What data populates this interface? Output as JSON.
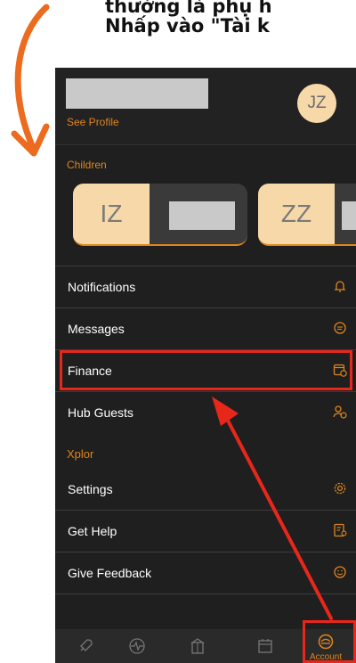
{
  "caption": {
    "line1": "thường là phụ h",
    "line2": "Nhấp vào \"Tài k"
  },
  "profile": {
    "see_profile": "See Profile",
    "avatar_initials": "JZ"
  },
  "children": {
    "label": "Children",
    "items": [
      {
        "initials": "IZ"
      },
      {
        "initials": "ZZ"
      }
    ]
  },
  "menu": {
    "items": [
      {
        "label": "Notifications",
        "icon": "bell-icon"
      },
      {
        "label": "Messages",
        "icon": "chat-bubble-icon"
      },
      {
        "label": "Finance",
        "icon": "wallet-dollar-icon"
      },
      {
        "label": "Hub Guests",
        "icon": "user-plus-icon"
      }
    ],
    "section": "Xplor",
    "section_items": [
      {
        "label": "Settings",
        "icon": "gear-icon"
      },
      {
        "label": "Get Help",
        "icon": "help-document-icon"
      },
      {
        "label": "Give Feedback",
        "icon": "feedback-smile-icon"
      }
    ]
  },
  "tabbar": {
    "tabs": [
      {
        "icon": "rocket-icon"
      },
      {
        "icon": "activity-icon"
      },
      {
        "icon": "building-icon"
      },
      {
        "icon": "calendar-icon"
      },
      {
        "icon": "account-icon",
        "label": "Account"
      }
    ]
  },
  "colors": {
    "accent": "#e0851e",
    "annotation_red": "#e8271b",
    "background": "#1f1f1f",
    "avatar": "#f7d9a9"
  }
}
